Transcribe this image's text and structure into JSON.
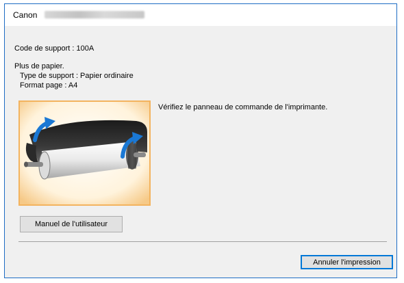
{
  "window": {
    "title": "Canon"
  },
  "info": {
    "support_code": "Code de support : 100A",
    "message": "Plus de papier.",
    "media_type": "Type de support : Papier ordinaire",
    "page_size": "Format page : A4"
  },
  "instruction": "Vérifiez le panneau de commande de l'imprimante.",
  "illustration": {
    "icon": "paper-roll-icon",
    "frame_color": "#f3b35e",
    "arrow_color": "#1a78d4"
  },
  "buttons": {
    "manual": "Manuel de l'utilisateur",
    "cancel": "Annuler l'impression"
  }
}
